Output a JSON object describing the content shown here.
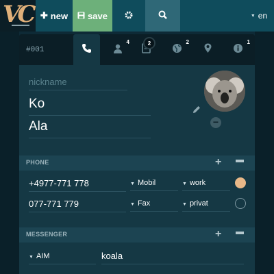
{
  "toolbar": {
    "new_label": "new",
    "save_label": "save",
    "language": "en"
  },
  "contact": {
    "id": "#001",
    "nickname_placeholder": "nickname",
    "first_name": "Ko",
    "last_name": "Ala"
  },
  "tabs": [
    {
      "icon": "phone-icon",
      "badge": ""
    },
    {
      "icon": "person-icon",
      "badge": "4"
    },
    {
      "icon": "document-icon",
      "badge": "2"
    },
    {
      "icon": "globe-icon",
      "badge": "2"
    },
    {
      "icon": "location-pin-icon",
      "badge": ""
    },
    {
      "icon": "info-icon",
      "badge": "1"
    }
  ],
  "phone": {
    "title": "PHONE",
    "rows": [
      {
        "number": "+4977-771 778",
        "type": "Mobil",
        "category": "work",
        "primary": true
      },
      {
        "number": "077-771 779",
        "type": "Fax",
        "category": "privat",
        "primary": false
      }
    ]
  },
  "messenger": {
    "title": "MESSENGER",
    "rows": [
      {
        "service": "AIM",
        "handle": "koala"
      }
    ]
  },
  "colors": {
    "toolbar": "#0f4c5c",
    "save_button": "#6db07a",
    "search_button": "#2f6877",
    "primary_radio": "#e8b888"
  }
}
